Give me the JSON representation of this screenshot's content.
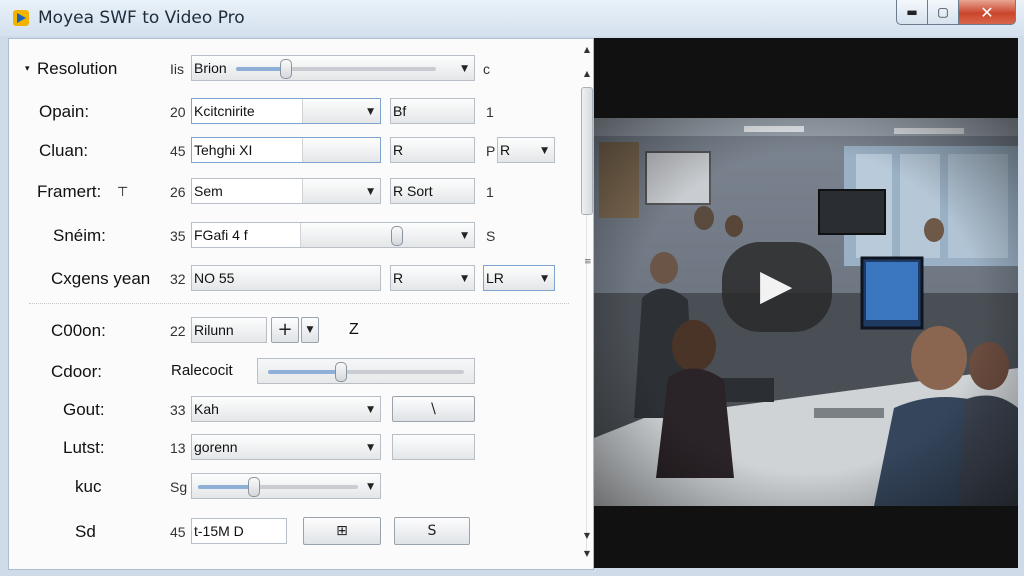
{
  "window": {
    "title": "Moyea SWF to Video Pro",
    "min_glyph": "▬",
    "max_glyph": "▢",
    "close_glyph": "✕"
  },
  "rows": {
    "resolution": {
      "label": "Resolution",
      "num": "Iis",
      "value": "Brion",
      "value_end": "c"
    },
    "opain": {
      "label": "Opain:",
      "num": "20",
      "value": "Kcitcnirite",
      "field2": "Bf",
      "value_end": "1"
    },
    "cluan": {
      "label": "Cluan:",
      "num": "45",
      "value": "Tehghi  XI",
      "field2": "R",
      "value_end": "P",
      "select3": "R"
    },
    "framert": {
      "label": "Framert:",
      "label_suffix": "⊤",
      "num": "26",
      "value": "Sem",
      "field2": "R Sort",
      "value_end": "1"
    },
    "sneim": {
      "label": "Snéim:",
      "num": "35",
      "value": "FGafi 4 f",
      "value_end": "S"
    },
    "cxgens": {
      "label": "Cxgens yean",
      "num": "32",
      "value": "NO 55",
      "field2": "R",
      "select3": "LR"
    },
    "c00on": {
      "label": "C00on:",
      "num": "22",
      "value": "Rilunn",
      "stepper": "+",
      "value_end": "Z"
    },
    "cdoor": {
      "label": "Cdoor:",
      "value": "Ralecocit"
    },
    "gout": {
      "label": "Gout:",
      "num": "33",
      "value": "Kah",
      "btn": "\\"
    },
    "lutst": {
      "label": "Lutst:",
      "num": "13",
      "value": "gorenn"
    },
    "kuc": {
      "label": "kuc",
      "num": "Sg"
    },
    "sd": {
      "label": "Sd",
      "num": "45",
      "value": "t-15M D",
      "btn1": "⊞",
      "btn2": "S"
    }
  },
  "slider_levels": {
    "resolution": 0.25,
    "sneim": 0.68,
    "cdoor": 0.37,
    "kuc": 0.35
  },
  "scrollbar": {
    "mark": "≡"
  },
  "video": {
    "play_glyph": "▶"
  }
}
